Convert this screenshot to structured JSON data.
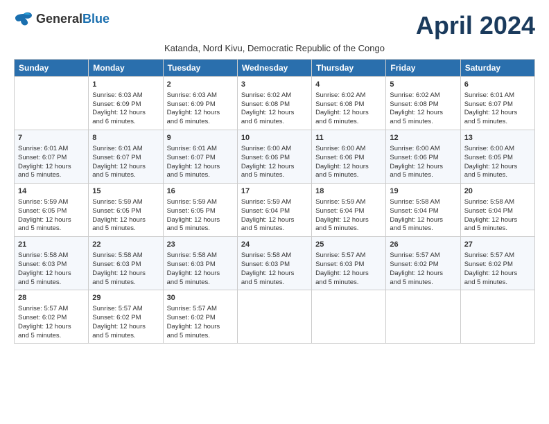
{
  "header": {
    "logo_general": "General",
    "logo_blue": "Blue",
    "title": "April 2024",
    "location": "Katanda, Nord Kivu, Democratic Republic of the Congo"
  },
  "weekdays": [
    "Sunday",
    "Monday",
    "Tuesday",
    "Wednesday",
    "Thursday",
    "Friday",
    "Saturday"
  ],
  "weeks": [
    [
      {
        "day": "",
        "info": ""
      },
      {
        "day": "1",
        "info": "Sunrise: 6:03 AM\nSunset: 6:09 PM\nDaylight: 12 hours\nand 6 minutes."
      },
      {
        "day": "2",
        "info": "Sunrise: 6:03 AM\nSunset: 6:09 PM\nDaylight: 12 hours\nand 6 minutes."
      },
      {
        "day": "3",
        "info": "Sunrise: 6:02 AM\nSunset: 6:08 PM\nDaylight: 12 hours\nand 6 minutes."
      },
      {
        "day": "4",
        "info": "Sunrise: 6:02 AM\nSunset: 6:08 PM\nDaylight: 12 hours\nand 6 minutes."
      },
      {
        "day": "5",
        "info": "Sunrise: 6:02 AM\nSunset: 6:08 PM\nDaylight: 12 hours\nand 5 minutes."
      },
      {
        "day": "6",
        "info": "Sunrise: 6:01 AM\nSunset: 6:07 PM\nDaylight: 12 hours\nand 5 minutes."
      }
    ],
    [
      {
        "day": "7",
        "info": "Sunrise: 6:01 AM\nSunset: 6:07 PM\nDaylight: 12 hours\nand 5 minutes."
      },
      {
        "day": "8",
        "info": "Sunrise: 6:01 AM\nSunset: 6:07 PM\nDaylight: 12 hours\nand 5 minutes."
      },
      {
        "day": "9",
        "info": "Sunrise: 6:01 AM\nSunset: 6:07 PM\nDaylight: 12 hours\nand 5 minutes."
      },
      {
        "day": "10",
        "info": "Sunrise: 6:00 AM\nSunset: 6:06 PM\nDaylight: 12 hours\nand 5 minutes."
      },
      {
        "day": "11",
        "info": "Sunrise: 6:00 AM\nSunset: 6:06 PM\nDaylight: 12 hours\nand 5 minutes."
      },
      {
        "day": "12",
        "info": "Sunrise: 6:00 AM\nSunset: 6:06 PM\nDaylight: 12 hours\nand 5 minutes."
      },
      {
        "day": "13",
        "info": "Sunrise: 6:00 AM\nSunset: 6:05 PM\nDaylight: 12 hours\nand 5 minutes."
      }
    ],
    [
      {
        "day": "14",
        "info": "Sunrise: 5:59 AM\nSunset: 6:05 PM\nDaylight: 12 hours\nand 5 minutes."
      },
      {
        "day": "15",
        "info": "Sunrise: 5:59 AM\nSunset: 6:05 PM\nDaylight: 12 hours\nand 5 minutes."
      },
      {
        "day": "16",
        "info": "Sunrise: 5:59 AM\nSunset: 6:05 PM\nDaylight: 12 hours\nand 5 minutes."
      },
      {
        "day": "17",
        "info": "Sunrise: 5:59 AM\nSunset: 6:04 PM\nDaylight: 12 hours\nand 5 minutes."
      },
      {
        "day": "18",
        "info": "Sunrise: 5:59 AM\nSunset: 6:04 PM\nDaylight: 12 hours\nand 5 minutes."
      },
      {
        "day": "19",
        "info": "Sunrise: 5:58 AM\nSunset: 6:04 PM\nDaylight: 12 hours\nand 5 minutes."
      },
      {
        "day": "20",
        "info": "Sunrise: 5:58 AM\nSunset: 6:04 PM\nDaylight: 12 hours\nand 5 minutes."
      }
    ],
    [
      {
        "day": "21",
        "info": "Sunrise: 5:58 AM\nSunset: 6:03 PM\nDaylight: 12 hours\nand 5 minutes."
      },
      {
        "day": "22",
        "info": "Sunrise: 5:58 AM\nSunset: 6:03 PM\nDaylight: 12 hours\nand 5 minutes."
      },
      {
        "day": "23",
        "info": "Sunrise: 5:58 AM\nSunset: 6:03 PM\nDaylight: 12 hours\nand 5 minutes."
      },
      {
        "day": "24",
        "info": "Sunrise: 5:58 AM\nSunset: 6:03 PM\nDaylight: 12 hours\nand 5 minutes."
      },
      {
        "day": "25",
        "info": "Sunrise: 5:57 AM\nSunset: 6:03 PM\nDaylight: 12 hours\nand 5 minutes."
      },
      {
        "day": "26",
        "info": "Sunrise: 5:57 AM\nSunset: 6:02 PM\nDaylight: 12 hours\nand 5 minutes."
      },
      {
        "day": "27",
        "info": "Sunrise: 5:57 AM\nSunset: 6:02 PM\nDaylight: 12 hours\nand 5 minutes."
      }
    ],
    [
      {
        "day": "28",
        "info": "Sunrise: 5:57 AM\nSunset: 6:02 PM\nDaylight: 12 hours\nand 5 minutes."
      },
      {
        "day": "29",
        "info": "Sunrise: 5:57 AM\nSunset: 6:02 PM\nDaylight: 12 hours\nand 5 minutes."
      },
      {
        "day": "30",
        "info": "Sunrise: 5:57 AM\nSunset: 6:02 PM\nDaylight: 12 hours\nand 5 minutes."
      },
      {
        "day": "",
        "info": ""
      },
      {
        "day": "",
        "info": ""
      },
      {
        "day": "",
        "info": ""
      },
      {
        "day": "",
        "info": ""
      }
    ]
  ]
}
